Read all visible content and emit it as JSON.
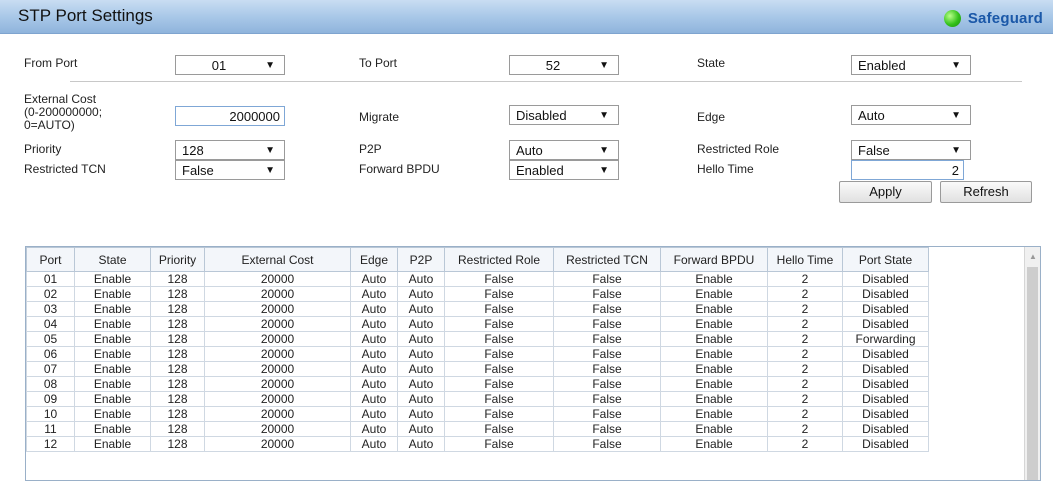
{
  "header": {
    "title": "STP Port Settings",
    "safeguard_label": "Safeguard"
  },
  "form": {
    "from_port_label": "From Port",
    "from_port_value": "01",
    "to_port_label": "To Port",
    "to_port_value": "52",
    "state_label": "State",
    "state_value": "Enabled",
    "external_cost_label_1": "External Cost",
    "external_cost_label_2": "(0-200000000;",
    "external_cost_label_3": "0=AUTO)",
    "external_cost_value": "2000000",
    "migrate_label": "Migrate",
    "migrate_value": "Disabled",
    "edge_label": "Edge",
    "edge_value": "Auto",
    "priority_label": "Priority",
    "priority_value": "128",
    "p2p_label": "P2P",
    "p2p_value": "Auto",
    "restricted_role_label": "Restricted Role",
    "restricted_role_value": "False",
    "restricted_tcn_label": "Restricted TCN",
    "restricted_tcn_value": "False",
    "forward_bpdu_label": "Forward BPDU",
    "forward_bpdu_value": "Enabled",
    "hello_time_label": "Hello Time",
    "hello_time_value": "2",
    "apply_label": "Apply",
    "refresh_label": "Refresh"
  },
  "table": {
    "headers": [
      "Port",
      "State",
      "Priority",
      "External Cost",
      "Edge",
      "P2P",
      "Restricted Role",
      "Restricted TCN",
      "Forward BPDU",
      "Hello Time",
      "Port State"
    ],
    "rows": [
      [
        "01",
        "Enable",
        "128",
        "20000",
        "Auto",
        "Auto",
        "False",
        "False",
        "Enable",
        "2",
        "Disabled"
      ],
      [
        "02",
        "Enable",
        "128",
        "20000",
        "Auto",
        "Auto",
        "False",
        "False",
        "Enable",
        "2",
        "Disabled"
      ],
      [
        "03",
        "Enable",
        "128",
        "20000",
        "Auto",
        "Auto",
        "False",
        "False",
        "Enable",
        "2",
        "Disabled"
      ],
      [
        "04",
        "Enable",
        "128",
        "20000",
        "Auto",
        "Auto",
        "False",
        "False",
        "Enable",
        "2",
        "Disabled"
      ],
      [
        "05",
        "Enable",
        "128",
        "20000",
        "Auto",
        "Auto",
        "False",
        "False",
        "Enable",
        "2",
        "Forwarding"
      ],
      [
        "06",
        "Enable",
        "128",
        "20000",
        "Auto",
        "Auto",
        "False",
        "False",
        "Enable",
        "2",
        "Disabled"
      ],
      [
        "07",
        "Enable",
        "128",
        "20000",
        "Auto",
        "Auto",
        "False",
        "False",
        "Enable",
        "2",
        "Disabled"
      ],
      [
        "08",
        "Enable",
        "128",
        "20000",
        "Auto",
        "Auto",
        "False",
        "False",
        "Enable",
        "2",
        "Disabled"
      ],
      [
        "09",
        "Enable",
        "128",
        "20000",
        "Auto",
        "Auto",
        "False",
        "False",
        "Enable",
        "2",
        "Disabled"
      ],
      [
        "10",
        "Enable",
        "128",
        "20000",
        "Auto",
        "Auto",
        "False",
        "False",
        "Enable",
        "2",
        "Disabled"
      ],
      [
        "11",
        "Enable",
        "128",
        "20000",
        "Auto",
        "Auto",
        "False",
        "False",
        "Enable",
        "2",
        "Disabled"
      ],
      [
        "12",
        "Enable",
        "128",
        "20000",
        "Auto",
        "Auto",
        "False",
        "False",
        "Enable",
        "2",
        "Disabled"
      ]
    ]
  },
  "icons": {
    "dropdown": "chevron-down-icon",
    "status": "green-status-dot-icon",
    "scroll_up": "scroll-up-arrow-icon"
  },
  "colors": {
    "title_bar": "#a9c8e8",
    "safeguard_text": "#1b58a8",
    "status_dot": "#33c11a"
  }
}
